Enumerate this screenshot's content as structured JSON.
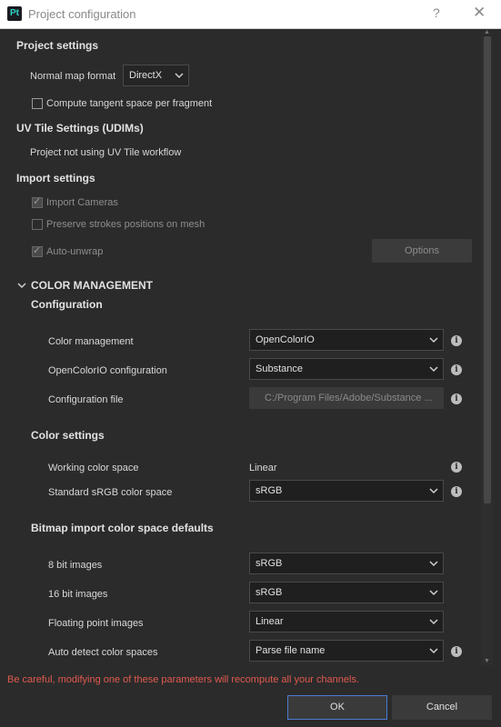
{
  "window": {
    "app_icon": "Pt",
    "title": "Project configuration",
    "help": "?",
    "close": "✕"
  },
  "project_settings": {
    "title": "Project settings",
    "normal_map_label": "Normal map format",
    "normal_map_value": "DirectX",
    "tangent_label": "Compute tangent space per fragment"
  },
  "uv_tile": {
    "title": "UV Tile Settings (UDIMs)",
    "status": "Project not using UV Tile workflow"
  },
  "import_settings": {
    "title": "Import settings",
    "import_cameras": "Import Cameras",
    "preserve_strokes": "Preserve strokes positions on mesh",
    "auto_unwrap": "Auto-unwrap",
    "options_button": "Options"
  },
  "color_management": {
    "title": "COLOR MANAGEMENT",
    "configuration_title": "Configuration",
    "color_management_label": "Color management",
    "color_management_value": "OpenColorIO",
    "ocio_config_label": "OpenColorIO configuration",
    "ocio_config_value": "Substance",
    "config_file_label": "Configuration file",
    "config_file_value": "C:/Program Files/Adobe/Substance ...",
    "color_settings_title": "Color settings",
    "working_space_label": "Working color space",
    "working_space_value": "Linear",
    "srgb_label": "Standard sRGB color space",
    "srgb_value": "sRGB",
    "bitmap_title": "Bitmap import color space defaults",
    "bit8_label": "8 bit images",
    "bit8_value": "sRGB",
    "bit16_label": "16 bit images",
    "bit16_value": "sRGB",
    "float_label": "Floating point images",
    "float_value": "Linear",
    "autodetect_label": "Auto detect color spaces",
    "autodetect_value": "Parse file name"
  },
  "footer": {
    "warning": "Be careful, modifying one of these parameters will recompute all your channels.",
    "ok": "OK",
    "cancel": "Cancel"
  }
}
